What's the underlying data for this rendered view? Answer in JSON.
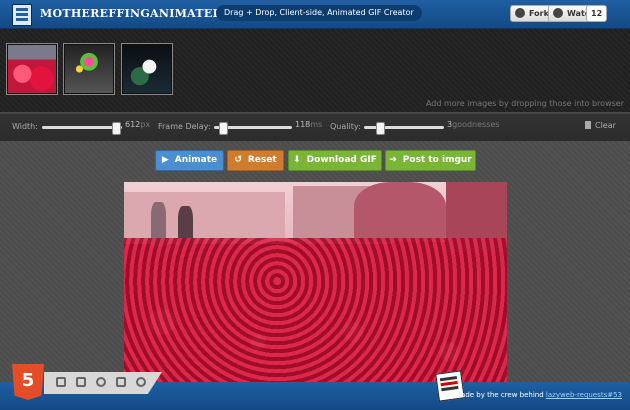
{
  "header": {
    "title": "MOTHEREFFINGANIMATEDGIF",
    "tagline": "Drag + Drop, Client-side, Animated GIF Creator",
    "fork_label": "Fork",
    "watch_label": "Watch",
    "watch_count": "12"
  },
  "thumbnails": {
    "items": [
      "red-flower-field",
      "colorful-flowers-dark",
      "white-flower-dark"
    ],
    "drop_hint": "Add more images by dropping those into browser"
  },
  "controls": {
    "width_label": "Width:",
    "width_value": "612",
    "width_unit": "px",
    "width_level": 0.93,
    "delay_label": "Frame Delay:",
    "delay_value": "118",
    "delay_unit": "ms",
    "delay_level": 0.12,
    "quality_label": "Quality:",
    "quality_value": "3",
    "quality_unit": "goodnesses",
    "quality_level": 0.2,
    "clear_label": "Clear"
  },
  "actions": {
    "animate_label": "Animate",
    "reset_label": "Reset",
    "download_label": "Download GIF",
    "imgur_label": "Post to imgur"
  },
  "footer": {
    "html5_label": "5",
    "made_by_prefix": "Made by the crew behind ",
    "made_by_link": "lazyweb-requests#53"
  },
  "colors": {
    "header_blue": "#1f5fa3",
    "animate_blue": "#4a8fd1",
    "reset_orange": "#cf7c2c",
    "action_green": "#7ab536",
    "html5_orange": "#e44d26"
  }
}
